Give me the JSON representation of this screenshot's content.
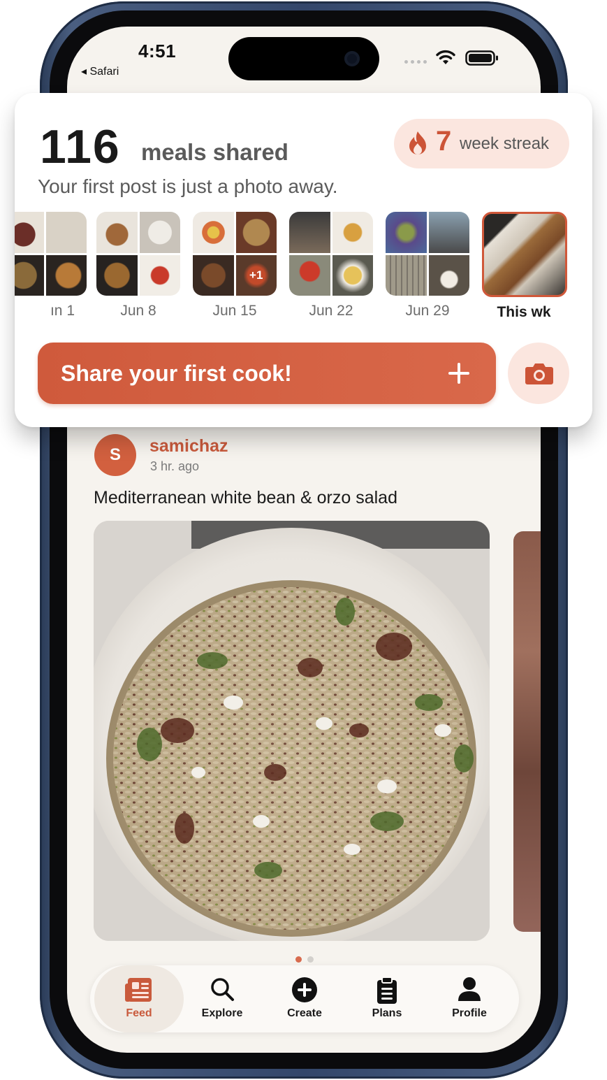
{
  "status_bar": {
    "time": "4:51",
    "back_app": "◂ Safari"
  },
  "summary_card": {
    "meals_count": "116",
    "meals_label": "meals shared",
    "streak_number": "7",
    "streak_label": "week streak",
    "subtitle": "Your first post is just a photo away.",
    "weeks": [
      {
        "label": "ın 1"
      },
      {
        "label": "Jun 8"
      },
      {
        "label": "Jun 15",
        "more": "+1"
      },
      {
        "label": "Jun 22"
      },
      {
        "label": "Jun 29"
      },
      {
        "label": "This wk"
      }
    ],
    "share_button_label": "Share your first cook!"
  },
  "post": {
    "avatar_initial": "S",
    "username": "samichaz",
    "time_ago": "3 hr. ago",
    "title": "Mediterranean white bean & orzo salad",
    "carousel_pages": 2,
    "carousel_current": 1
  },
  "tab_bar": {
    "tabs": [
      {
        "label": "Feed",
        "icon": "feed-icon",
        "active": true
      },
      {
        "label": "Explore",
        "icon": "search-icon",
        "active": false
      },
      {
        "label": "Create",
        "icon": "create-plus-icon",
        "active": false
      },
      {
        "label": "Plans",
        "icon": "clipboard-icon",
        "active": false
      },
      {
        "label": "Profile",
        "icon": "person-icon",
        "active": false
      }
    ]
  },
  "colors": {
    "accent": "#cf5a3c",
    "accent_light": "#fbe6df",
    "screen_bg": "#f6f3ee"
  }
}
